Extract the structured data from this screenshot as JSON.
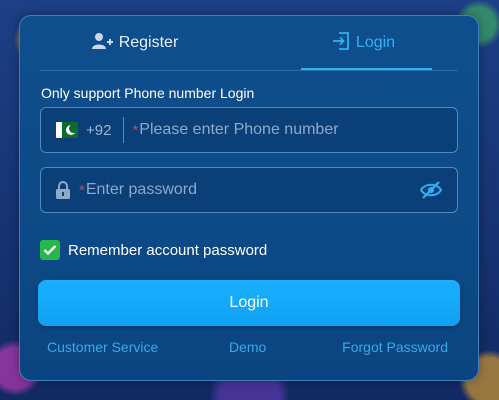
{
  "tabs": {
    "register_label": "Register",
    "login_label": "Login",
    "active": "login"
  },
  "form": {
    "subtitle": "Only support Phone number Login",
    "phone": {
      "country_flag": "pakistan-flag-icon",
      "country_code": "+92",
      "required_mark": "*",
      "placeholder": "Please enter Phone number",
      "value": ""
    },
    "password": {
      "required_mark": "*",
      "placeholder": "Enter password",
      "value": ""
    },
    "remember": {
      "label": "Remember account password",
      "checked": true
    },
    "submit_label": "Login"
  },
  "footer_links": {
    "customer_service": "Customer Service",
    "demo": "Demo",
    "forgot_password": "Forgot Password"
  },
  "colors": {
    "panel": "#0f4f8d",
    "accent": "#2fb1f3",
    "button": "#1ab0ff",
    "checkbox": "#27b84a",
    "required": "#e0413f"
  }
}
